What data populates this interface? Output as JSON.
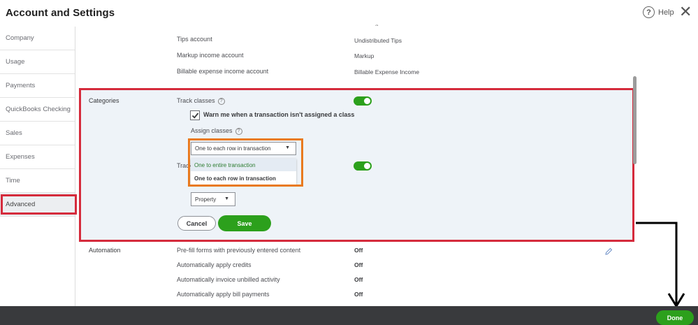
{
  "header": {
    "title": "Account and Settings",
    "help_label": "Help"
  },
  "sidebar": {
    "items": [
      {
        "label": "Company"
      },
      {
        "label": "Usage"
      },
      {
        "label": "Payments"
      },
      {
        "label": "QuickBooks Checking"
      },
      {
        "label": "Sales"
      },
      {
        "label": "Expenses"
      },
      {
        "label": "Time"
      },
      {
        "label": "Advanced"
      }
    ],
    "active": "Advanced"
  },
  "top_rows": [
    {
      "label": "Tips account",
      "value": "Undistributed Tips"
    },
    {
      "label": "Markup income account",
      "value": "Markup"
    },
    {
      "label": "Billable expense income account",
      "value": "Billable Expense Income"
    }
  ],
  "categories": {
    "section_label": "Categories",
    "track_classes_label": "Track classes",
    "track_classes_on": true,
    "warn_label": "Warn me when a transaction isn't assigned a class",
    "warn_checked": true,
    "assign_classes_label": "Assign classes",
    "assign_select_value": "One to each row in transaction",
    "assign_options": [
      "One to entire transaction",
      "One to each row in transaction"
    ],
    "track_locations_label_partial": "Track",
    "track_locations_on": true,
    "location_select_value": "Property",
    "cancel_label": "Cancel",
    "save_label": "Save"
  },
  "automation": {
    "section_label": "Automation",
    "rows": [
      {
        "label": "Pre-fill forms with previously entered content",
        "value": "Off"
      },
      {
        "label": "Automatically apply credits",
        "value": "Off"
      },
      {
        "label": "Automatically invoice unbilled activity",
        "value": "Off"
      },
      {
        "label": "Automatically apply bill payments",
        "value": "Off"
      }
    ]
  },
  "footer": {
    "done_label": "Done"
  },
  "colors": {
    "accent_green": "#2ca01c",
    "highlight_red": "#d52b3c",
    "highlight_orange": "#e97a1f",
    "bottom_bar": "#393a3d"
  }
}
